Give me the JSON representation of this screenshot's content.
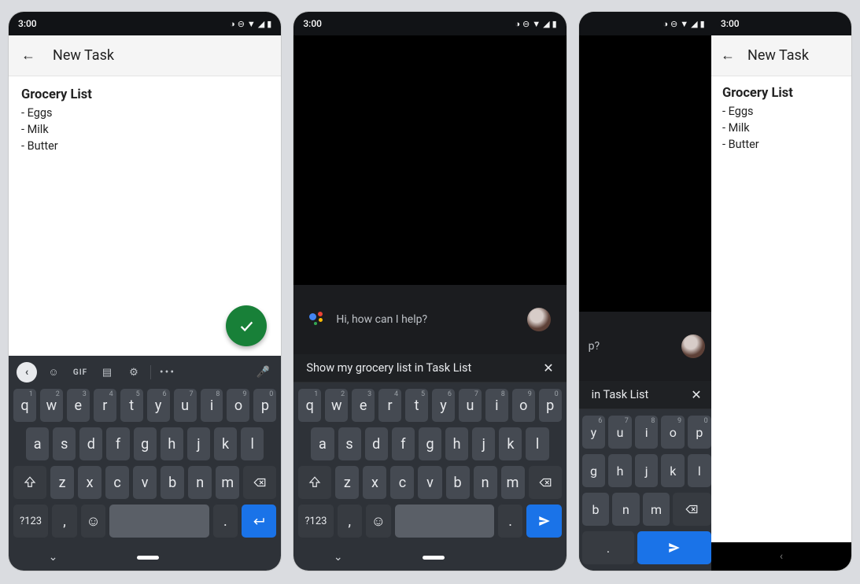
{
  "status": {
    "time": "3:00",
    "icons": [
      "◑",
      "⊖",
      "▼",
      "◢",
      "▮"
    ]
  },
  "phone1": {
    "appbar_title": "New Task",
    "title": "Grocery List",
    "items": [
      "- Eggs",
      "- Milk",
      "- Butter"
    ]
  },
  "assistant": {
    "greeting": "Hi, how can I help?",
    "query": "Show my grocery list in Task List",
    "query_partial": "in Task List"
  },
  "keyboard": {
    "toolbar": {
      "gif": "GIF"
    },
    "row1": [
      {
        "l": "q",
        "n": "1"
      },
      {
        "l": "w",
        "n": "2"
      },
      {
        "l": "e",
        "n": "3"
      },
      {
        "l": "r",
        "n": "4"
      },
      {
        "l": "t",
        "n": "5"
      },
      {
        "l": "y",
        "n": "6"
      },
      {
        "l": "u",
        "n": "7"
      },
      {
        "l": "i",
        "n": "8"
      },
      {
        "l": "o",
        "n": "9"
      },
      {
        "l": "p",
        "n": "0"
      }
    ],
    "row2": [
      "a",
      "s",
      "d",
      "f",
      "g",
      "h",
      "j",
      "k",
      "l"
    ],
    "row3": [
      "z",
      "x",
      "c",
      "v",
      "b",
      "n",
      "m"
    ],
    "sym": "?123",
    "comma": ",",
    "period": "."
  },
  "split": {
    "appbar_title": "New Task",
    "title": "Grocery List",
    "items": [
      "- Eggs",
      "- Milk",
      "- Butter"
    ],
    "partial_row1": [
      {
        "l": "y",
        "n": "6"
      },
      {
        "l": "u",
        "n": "7"
      },
      {
        "l": "i",
        "n": "8"
      },
      {
        "l": "o",
        "n": "9"
      },
      {
        "l": "p",
        "n": "0"
      }
    ],
    "partial_row2": [
      "g",
      "h",
      "j",
      "k",
      "l"
    ],
    "partial_row3": [
      "b",
      "n",
      "m"
    ],
    "partial_greeting": "p?"
  }
}
